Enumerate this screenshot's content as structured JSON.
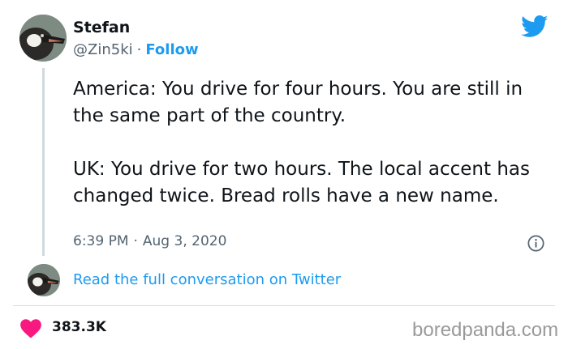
{
  "tweet": {
    "display_name": "Stefan",
    "handle": "@Zin5ki",
    "separator": "·",
    "follow_label": "Follow",
    "text_paragraph_1": "America: You drive for four hours. You are still in the same part of the country.",
    "text_paragraph_2": "UK: You drive for two hours. The local accent has changed twice. Bread rolls have a new name.",
    "time": "6:39 PM",
    "date": "Aug 3, 2020",
    "read_conversation_label": "Read the full conversation on Twitter",
    "like_count": "383.3K"
  },
  "watermark": "boredpanda.com",
  "icons": {
    "brand": "twitter-bird-icon",
    "info": "info-icon",
    "like": "heart-icon",
    "avatar": "goose-avatar"
  },
  "colors": {
    "link_blue": "#1d9bf0",
    "heart_red": "#f91880",
    "text_dark": "#0f1419",
    "text_gray": "#536471"
  }
}
